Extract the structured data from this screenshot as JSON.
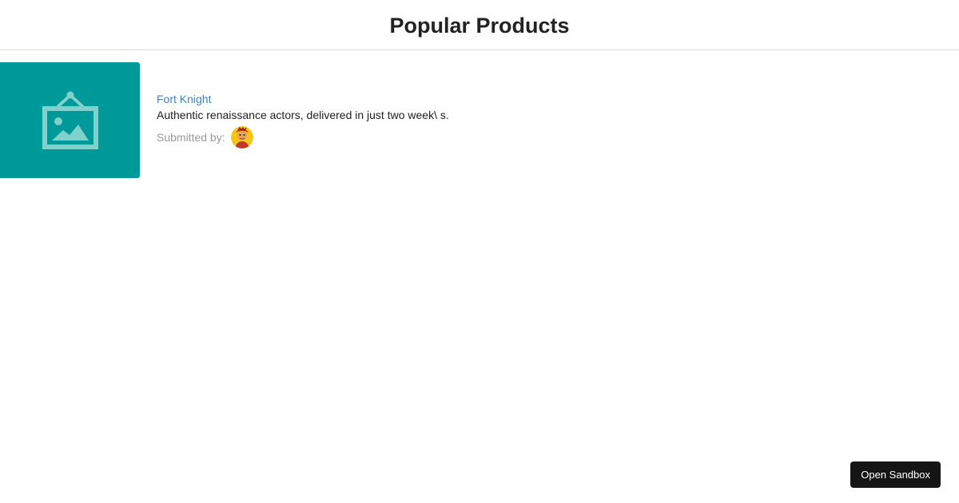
{
  "header": {
    "title": "Popular Products"
  },
  "products": [
    {
      "name": "Fort Knight",
      "description": "Authentic renaissance actors, delivered in just two week\\ s.",
      "submitted_label": "Submitted by:",
      "thumbnail_icon": "image-placeholder-icon",
      "thumbnail_color": "#009999",
      "avatar_icon": "avatar-icon"
    }
  ],
  "sandbox": {
    "label": "Open Sandbox"
  },
  "colors": {
    "link": "#4183c4",
    "text": "#222222",
    "muted": "#999999",
    "button_bg": "#151515"
  }
}
